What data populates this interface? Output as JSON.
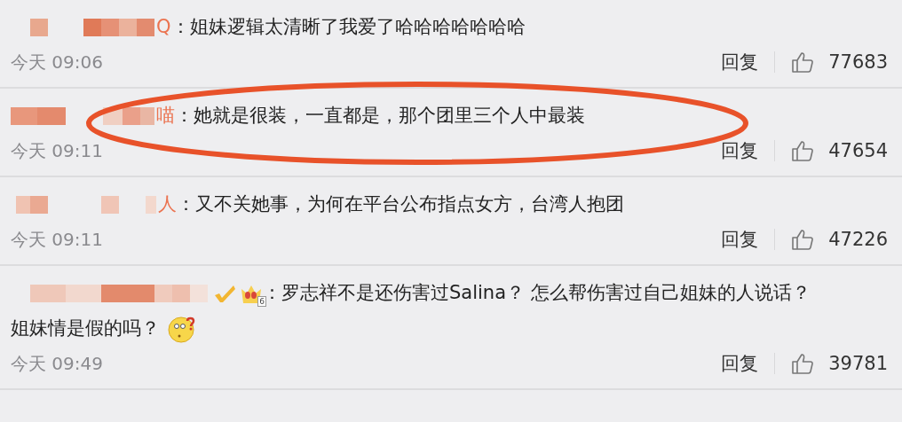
{
  "comments": [
    {
      "name_tail": "Q",
      "colon": "：",
      "text": "姐妹逻辑太清晰了我爱了哈哈哈哈哈哈哈",
      "time": "今天 09:06",
      "reply": "回复",
      "likes": "77683",
      "highlighted": false
    },
    {
      "name_tail": "喵",
      "colon": "：",
      "text": "她就是很装，一直都是，那个团里三个人中最装",
      "time": "今天 09:11",
      "reply": "回复",
      "likes": "47654",
      "highlighted": true
    },
    {
      "name_tail": "人",
      "colon": "：",
      "text": "又不关她事，为何在平台公布指点女方，台湾人抱团",
      "time": "今天 09:11",
      "reply": "回复",
      "likes": "47226",
      "highlighted": false
    },
    {
      "badges": true,
      "badge_text": "6",
      "colon": "：",
      "text": "罗志祥不是还伤害过Salina？ 怎么帮伤害过自己姐妹的人说话？",
      "text_line2": "姐妹情是假的吗？",
      "emoji": true,
      "time": "今天 09:49",
      "reply": "回复",
      "likes": "39781",
      "highlighted": false
    }
  ]
}
